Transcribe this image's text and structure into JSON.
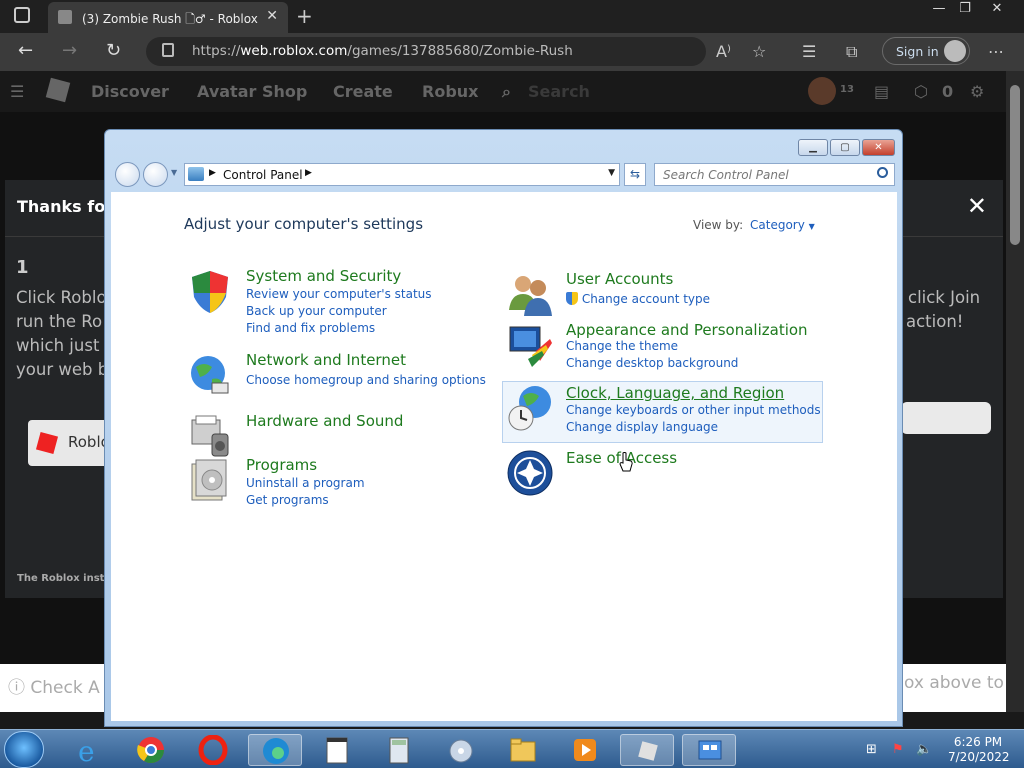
{
  "browser": {
    "tab_title": "(3) Zombie Rush 🗋♂ - Roblox",
    "url_prefix": "https://",
    "url_host": "web.roblox.com",
    "url_path": "/games/137885680/Zombie-Rush",
    "signin_label": "Sign in"
  },
  "roblox": {
    "nav": [
      "Discover",
      "Avatar Shop",
      "Create",
      "Robux",
      "Search"
    ],
    "robux": "0",
    "notif_count": "13",
    "modal_header": "Thanks for",
    "step_number": "1",
    "left_lines": [
      "Click Roblo",
      "run the Ro",
      "which just",
      "your web b"
    ],
    "right_lines": [
      "click Join",
      "action!"
    ],
    "button_label": "Roblo",
    "footer": "The Roblox insta",
    "bottom_left": "Check A",
    "bottom_right": "ox above to"
  },
  "control_panel": {
    "breadcrumb": "Control Panel",
    "search_placeholder": "Search Control Panel",
    "heading": "Adjust your computer's settings",
    "view_by_label": "View by:",
    "view_by_value": "Category",
    "categories": [
      {
        "title": "System and Security",
        "links": [
          "Review your computer's status",
          "Back up your computer",
          "Find and fix problems"
        ]
      },
      {
        "title": "Network and Internet",
        "links": [
          "Choose homegroup and sharing options"
        ]
      },
      {
        "title": "Hardware and Sound",
        "links": []
      },
      {
        "title": "Programs",
        "links": [
          "Uninstall a program",
          "Get programs"
        ]
      },
      {
        "title": "User Accounts",
        "links": [
          "Change account type"
        ]
      },
      {
        "title": "Appearance and Personalization",
        "links": [
          "Change the theme",
          "Change desktop background"
        ]
      },
      {
        "title": "Clock, Language, and Region",
        "links": [
          "Change keyboards or other input methods",
          "Change display language"
        ]
      },
      {
        "title": "Ease of Access",
        "links": []
      }
    ]
  },
  "taskbar": {
    "time": "6:26 PM",
    "date": "7/20/2022"
  }
}
